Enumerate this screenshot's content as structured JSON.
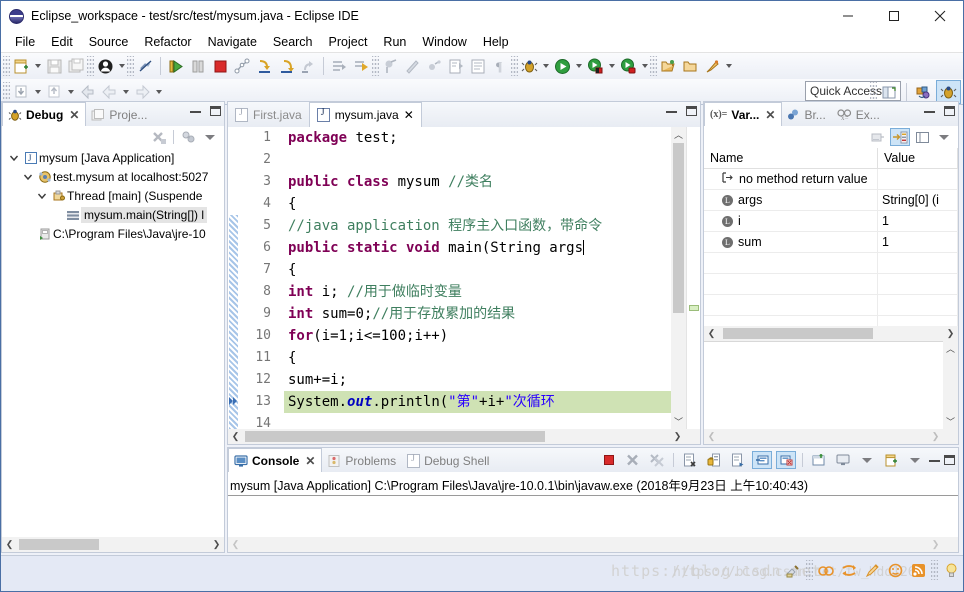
{
  "window": {
    "title": "Eclipse_workspace - test/src/test/mysum.java - Eclipse IDE",
    "minimize": "—",
    "maximize": "☐",
    "close": "✕"
  },
  "menubar": {
    "items": [
      {
        "label": "File"
      },
      {
        "label": "Edit"
      },
      {
        "label": "Source"
      },
      {
        "label": "Refactor"
      },
      {
        "label": "Navigate"
      },
      {
        "label": "Search"
      },
      {
        "label": "Project"
      },
      {
        "label": "Run"
      },
      {
        "label": "Window"
      },
      {
        "label": "Help"
      }
    ]
  },
  "toolbar": {
    "quick_access_placeholder": "Quick Access",
    "icons_row1": [
      "new-wizard-icon",
      "save-icon",
      "save-all-icon",
      "person-icon",
      "no-link-icon",
      "resume-icon",
      "suspend-icon",
      "terminate-icon",
      "disconnect-icon",
      "step-into-icon",
      "step-over-icon",
      "step-return-icon",
      "drop-to-frame-icon",
      "use-step-filters-icon",
      "toggle-breakpoint-icon",
      "skip-breakpoints-icon",
      "remove-breakpoints-icon",
      "open-type-icon",
      "open-task-icon",
      "mark-occurrences-icon",
      "show-whitespace-icon",
      "debug-icon",
      "run-icon",
      "coverage-icon",
      "profile-icon",
      "open-perspective-icon",
      "external-tools-icon",
      "search-icon"
    ],
    "icons_row2": [
      "import-icon",
      "export-icon",
      "back-icon",
      "prev-icon",
      "next-icon"
    ],
    "perspective_icons": [
      "open-perspective-icon",
      "java-perspective-icon",
      "debug-perspective-icon"
    ]
  },
  "debug_view": {
    "tabs": [
      {
        "label": "Debug",
        "icon": "bug-icon",
        "active": true,
        "closable": true
      },
      {
        "label": "Proje...",
        "icon": "project-explorer-icon",
        "active": false,
        "closable": false
      }
    ],
    "toolbar_icons": [
      "remove-all-terminated-icon",
      "view-menu-icon",
      "collapse-icon"
    ],
    "tree": [
      {
        "depth": 0,
        "expanded": true,
        "icon": "launch-icon",
        "label": "mysum [Java Application]",
        "selected": false
      },
      {
        "depth": 1,
        "expanded": true,
        "icon": "debug-target-icon",
        "label": "test.mysum at localhost:5027",
        "selected": false
      },
      {
        "depth": 2,
        "expanded": true,
        "icon": "thread-icon",
        "label": "Thread [main] (Suspende",
        "selected": false
      },
      {
        "depth": 3,
        "expanded": null,
        "icon": "stackframe-icon",
        "label": "mysum.main(String[]) l",
        "selected": true
      },
      {
        "depth": 1,
        "expanded": null,
        "icon": "jre-icon",
        "label": "C:\\Program Files\\Java\\jre-10",
        "selected": false
      }
    ]
  },
  "editor": {
    "tabs": [
      {
        "label": "First.java",
        "active": false,
        "closable": false
      },
      {
        "label": "mysum.java",
        "active": true,
        "closable": true
      }
    ],
    "lines": [
      {
        "n": 1,
        "fold": false,
        "highlight": false,
        "tokens": [
          {
            "t": "package ",
            "c": "kw2"
          },
          {
            "t": "test;",
            "c": "plain"
          }
        ]
      },
      {
        "n": 2,
        "fold": false,
        "highlight": false,
        "tokens": []
      },
      {
        "n": 3,
        "fold": false,
        "highlight": false,
        "tokens": [
          {
            "t": "public class ",
            "c": "kw2"
          },
          {
            "t": "mysum   ",
            "c": "plain"
          },
          {
            "t": "//类名",
            "c": "cmt"
          }
        ]
      },
      {
        "n": 4,
        "fold": false,
        "highlight": false,
        "tokens": [
          {
            "t": "{",
            "c": "plain"
          }
        ]
      },
      {
        "n": 5,
        "fold": false,
        "highlight": false,
        "tokens": [
          {
            "t": "    //java application 程序主入口函数，带命令",
            "c": "cmt"
          }
        ]
      },
      {
        "n": 6,
        "fold": true,
        "highlight": false,
        "tokens": [
          {
            "t": "    ",
            "c": "plain"
          },
          {
            "t": "public static void ",
            "c": "kw2"
          },
          {
            "t": "main(String args",
            "c": "plain"
          }
        ]
      },
      {
        "n": 7,
        "fold": false,
        "highlight": false,
        "tokens": [
          {
            "t": "    {",
            "c": "plain"
          }
        ]
      },
      {
        "n": 8,
        "fold": false,
        "highlight": false,
        "tokens": [
          {
            "t": "    ",
            "c": "plain"
          },
          {
            "t": "int",
            "c": "kw2"
          },
          {
            "t": " i; ",
            "c": "plain"
          },
          {
            "t": "//用于做临时变量",
            "c": "cmt"
          }
        ]
      },
      {
        "n": 9,
        "fold": false,
        "highlight": false,
        "tokens": [
          {
            "t": "    ",
            "c": "plain"
          },
          {
            "t": "int",
            "c": "kw2"
          },
          {
            "t": " sum=0;",
            "c": "plain"
          },
          {
            "t": "//用于存放累加的结果",
            "c": "cmt"
          }
        ]
      },
      {
        "n": 10,
        "fold": false,
        "highlight": false,
        "tokens": [
          {
            "t": "    ",
            "c": "plain"
          },
          {
            "t": "for",
            "c": "kw2"
          },
          {
            "t": "(i=1;i<=100;i++)",
            "c": "plain"
          }
        ]
      },
      {
        "n": 11,
        "fold": false,
        "highlight": false,
        "tokens": [
          {
            "t": "    {",
            "c": "plain"
          }
        ]
      },
      {
        "n": 12,
        "fold": false,
        "highlight": false,
        "tokens": [
          {
            "t": "        sum+=i;",
            "c": "plain"
          }
        ]
      },
      {
        "n": 13,
        "fold": false,
        "highlight": true,
        "tokens": [
          {
            "t": "        System.",
            "c": "plain"
          },
          {
            "t": "out",
            "c": "fld"
          },
          {
            "t": ".println(",
            "c": "plain"
          },
          {
            "t": "\"第\"",
            "c": "str"
          },
          {
            "t": "+i+",
            "c": "plain"
          },
          {
            "t": "\"次循环",
            "c": "str"
          }
        ]
      },
      {
        "n": 14,
        "fold": false,
        "highlight": false,
        "tokens": []
      }
    ],
    "current_line_marker": "instruction-pointer"
  },
  "variables_view": {
    "tabs": [
      {
        "label": "Var...",
        "icon": "variables-icon",
        "active": true,
        "closable": true
      },
      {
        "label": "Br...",
        "icon": "breakpoints-icon",
        "active": false,
        "closable": false
      },
      {
        "label": "Ex...",
        "icon": "expressions-icon",
        "active": false,
        "closable": false
      }
    ],
    "toolbar_icons": [
      "show-logical-structure-icon",
      "collapse-all-icon",
      "show-detail-pane-icon",
      "view-menu-icon"
    ],
    "columns": [
      "Name",
      "Value"
    ],
    "rows": [
      {
        "icon": "method-return-icon",
        "name": "no method return value",
        "value": ""
      },
      {
        "icon": "local-variable-icon",
        "name": "args",
        "value": "String[0]  (i"
      },
      {
        "icon": "local-variable-icon",
        "name": "i",
        "value": "1"
      },
      {
        "icon": "local-variable-icon",
        "name": "sum",
        "value": "1"
      },
      {
        "icon": "",
        "name": "",
        "value": ""
      },
      {
        "icon": "",
        "name": "",
        "value": ""
      },
      {
        "icon": "",
        "name": "",
        "value": ""
      },
      {
        "icon": "",
        "name": "",
        "value": ""
      }
    ]
  },
  "console_view": {
    "tabs": [
      {
        "label": "Console",
        "icon": "console-icon",
        "active": true,
        "closable": true
      },
      {
        "label": "Problems",
        "icon": "problems-icon",
        "active": false,
        "closable": false
      },
      {
        "label": "Debug Shell",
        "icon": "debug-shell-icon",
        "active": false,
        "closable": false
      }
    ],
    "toolbar_icons": [
      "terminate-icon",
      "remove-launch-icon",
      "remove-all-launches-icon",
      "clear-console-icon",
      "lock-scroll-icon",
      "word-wrap-icon",
      "show-console-on-output-icon",
      "show-console-on-error-icon",
      "pin-console-icon",
      "display-selected-console-icon",
      "open-console-icon"
    ],
    "output_header": "mysum [Java Application] C:\\Program Files\\Java\\jre-10.0.1\\bin\\javaw.exe (2018年9月23日 上午10:40:43)"
  },
  "statusbar": {
    "watermark": "https://blog.csdn.net",
    "watermark2": "https://blog.csdn.net/fw_hdd126",
    "tray_icons": [
      "writable-icon",
      "smart-insert-icon",
      "sync-icon",
      "pencil-icon",
      "face-icon",
      "rss-icon",
      "tip-icon"
    ]
  }
}
